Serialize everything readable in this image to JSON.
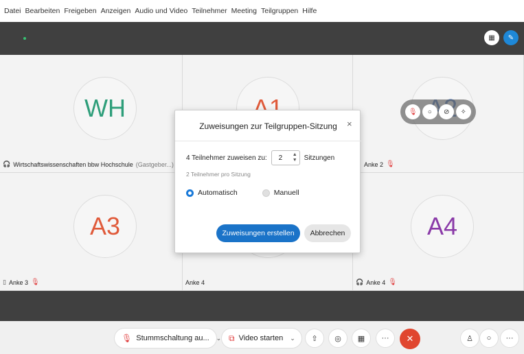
{
  "menu": [
    "Datei",
    "Bearbeiten",
    "Freigeben",
    "Anzeigen",
    "Audio und Video",
    "Teilnehmer",
    "Meeting",
    "Teilgruppen",
    "Hilfe"
  ],
  "top_buttons": {
    "grid_icon": "grid-icon",
    "pin_icon": "pin-icon"
  },
  "tiles": [
    {
      "initials": "WH",
      "color": "#2e9e7a",
      "name": "Wirtschaftswissenschaften bbw Hochschule",
      "sub": "(Gastgeber...)",
      "icon": "headset-icon"
    },
    {
      "initials": "A1",
      "color": "#e05a3a",
      "name": "",
      "sub": "",
      "icon": ""
    },
    {
      "initials": "A2",
      "color": "#2a5db0",
      "name": "Anke 2",
      "sub": "",
      "icon": ""
    },
    {
      "initials": "A3",
      "color": "#e05a3a",
      "name": "Anke 3",
      "sub": "",
      "icon": "phone-icon"
    },
    {
      "initials": "",
      "color": "#2a5db0",
      "name": "Anke 4",
      "sub": "",
      "icon": ""
    },
    {
      "initials": "A4",
      "color": "#8a3aa8",
      "name": "Anke 4",
      "sub": "",
      "icon": "headset-icon"
    }
  ],
  "dialog": {
    "title": "Zuweisungen zur Teilgruppen-Sitzung",
    "close": "×",
    "assign_label": "4 Teilnehmer zuweisen zu:",
    "stepper_value": "2",
    "sessions_label": "Sitzungen",
    "per_session": "2 Teilnehmer pro Sitzung",
    "radio_auto": "Automatisch",
    "radio_manual": "Manuell",
    "selected": "Automatisch",
    "btn_create": "Zuweisungen erstellen",
    "btn_cancel": "Abbrechen"
  },
  "controls": {
    "mute_label": "Stummschaltung au...",
    "video_label": "Video starten"
  },
  "colors": {
    "accent": "#1a73c8",
    "end_call": "#e0462f",
    "mic_off": "#e04040"
  }
}
